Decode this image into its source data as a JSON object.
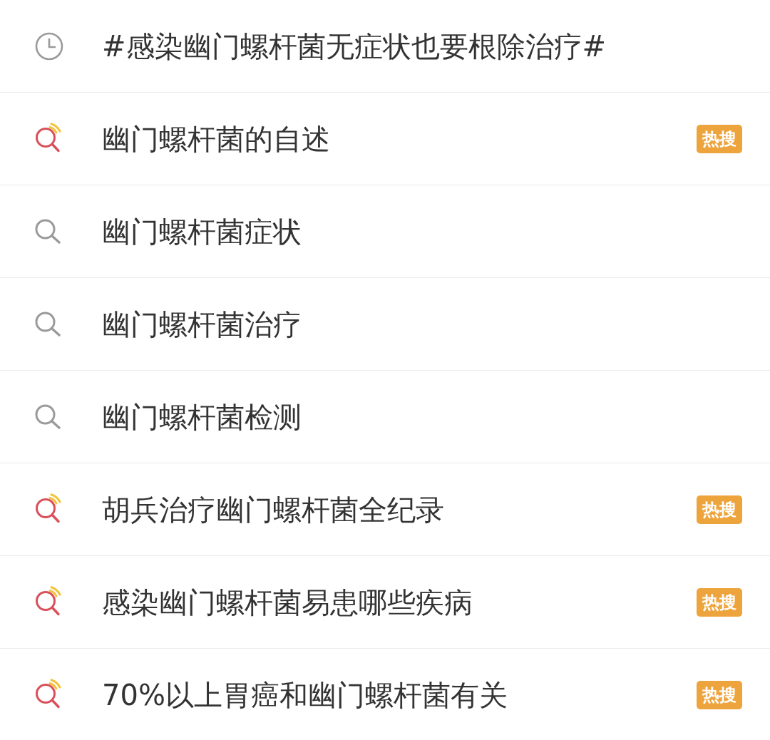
{
  "suggestions": [
    {
      "kind": "history",
      "text": "#感染幽门螺杆菌无症状也要根除治疗#"
    },
    {
      "kind": "hot",
      "text": "幽门螺杆菌的自述",
      "badge": "热搜"
    },
    {
      "kind": "search",
      "text": "幽门螺杆菌症状"
    },
    {
      "kind": "search",
      "text": "幽门螺杆菌治疗"
    },
    {
      "kind": "search",
      "text": "幽门螺杆菌检测"
    },
    {
      "kind": "hot",
      "text": "胡兵治疗幽门螺杆菌全纪录",
      "badge": "热搜"
    },
    {
      "kind": "hot",
      "text": "感染幽门螺杆菌易患哪些疾病",
      "badge": "热搜"
    },
    {
      "kind": "hot",
      "text": "70%以上胃癌和幽门螺杆菌有关",
      "badge": "热搜"
    }
  ]
}
